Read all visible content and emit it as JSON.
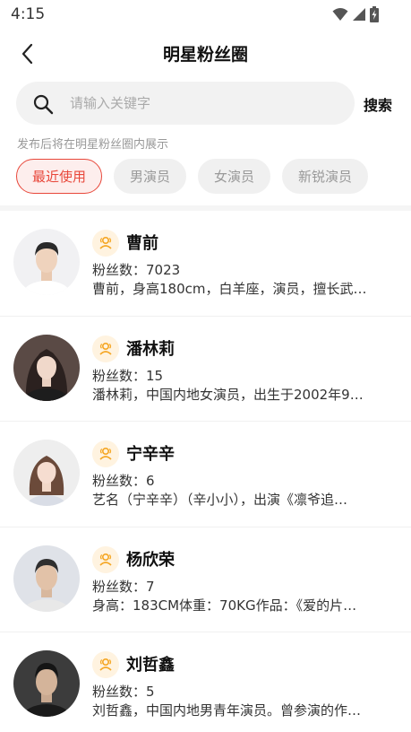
{
  "status_bar": {
    "time": "4:15"
  },
  "nav": {
    "title": "明星粉丝圈"
  },
  "search": {
    "placeholder": "请输入关键字",
    "button_label": "搜索"
  },
  "hint": "发布后将在明星粉丝圈内展示",
  "tabs": [
    {
      "label": "最近使用",
      "active": true
    },
    {
      "label": "男演员",
      "active": false
    },
    {
      "label": "女演员",
      "active": false
    },
    {
      "label": "新锐演员",
      "active": false
    }
  ],
  "fans_prefix": "粉丝数：",
  "stars": [
    {
      "name": "曹前",
      "fans": "7023",
      "desc": "曹前，身高180cm，白羊座，演员，擅长武…"
    },
    {
      "name": "潘林莉",
      "fans": "15",
      "desc": "潘林莉，中国内地女演员，出生于2002年9…"
    },
    {
      "name": "宁辛辛",
      "fans": "6",
      "desc": "艺名（宁辛辛）（辛小小），出演《凛爷追…"
    },
    {
      "name": "杨欣荣",
      "fans": "7",
      "desc": "身高：183CM体重：70KG作品：《爱的片…"
    },
    {
      "name": "刘哲鑫",
      "fans": "5",
      "desc": "刘哲鑫，中国内地男青年演员。曾参演的作…"
    }
  ],
  "colors": {
    "accent": "#e8473a",
    "badge_bg": "#fff3e0",
    "badge_icon": "#f5a623"
  }
}
